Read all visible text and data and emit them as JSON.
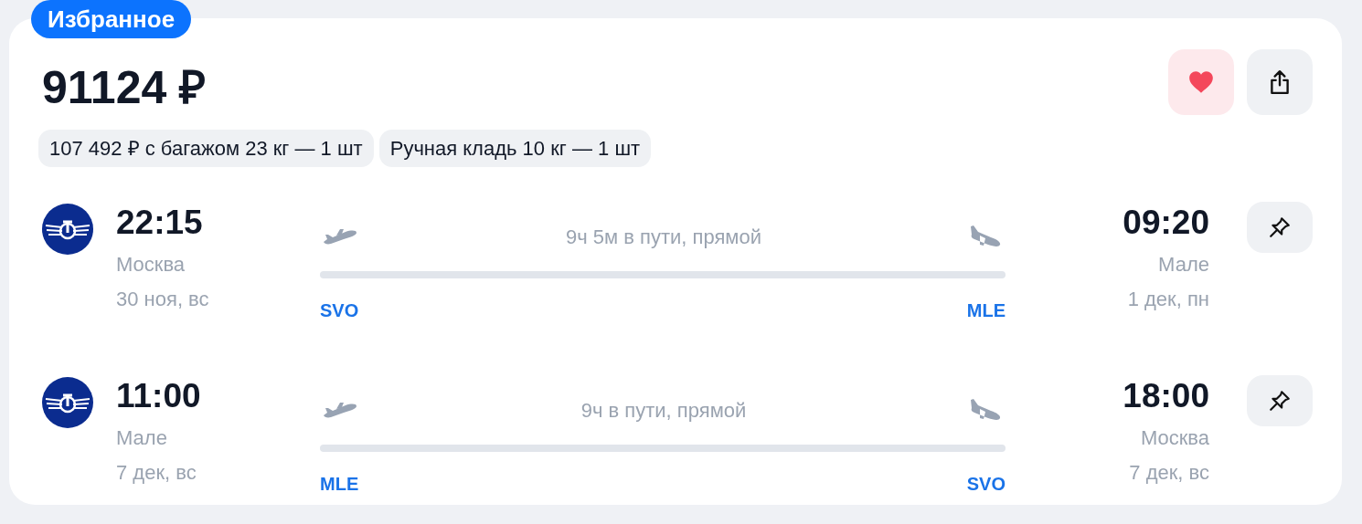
{
  "badge": "Избранное",
  "price": "91124 ₽",
  "favorite": true,
  "chips": [
    "107 492 ₽ с багажом 23 кг — 1 шт",
    "Ручная кладь 10 кг — 1 шт"
  ],
  "flights": [
    {
      "depart_time": "22:15",
      "depart_city": "Москва",
      "depart_date": "30 ноя, вс",
      "duration": "9ч 5м в пути, прямой",
      "from_code": "SVO",
      "to_code": "MLE",
      "arrive_time": "09:20",
      "arrive_city": "Мале",
      "arrive_date": "1 дек, пн"
    },
    {
      "depart_time": "11:00",
      "depart_city": "Мале",
      "depart_date": "7 дек, вс",
      "duration": "9ч в пути, прямой",
      "from_code": "MLE",
      "to_code": "SVO",
      "arrive_time": "18:00",
      "arrive_city": "Москва",
      "arrive_date": "7 дек, вс"
    }
  ]
}
